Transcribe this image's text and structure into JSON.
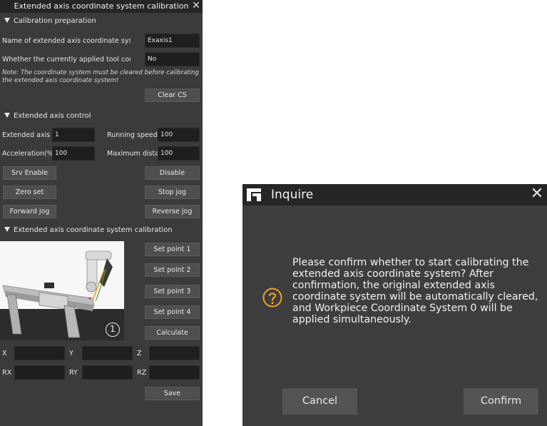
{
  "panel": {
    "title": "Extended axis coordinate system calibration",
    "section_prep": "Calibration preparation",
    "cs_name_label": "Name of extended axis coordinate system",
    "cs_name_value": "Exaxis1",
    "tool_label": "Whether the currently applied tool coordi",
    "tool_value": "No",
    "note": "Note: The coordinate system must be cleared before calibrating the extended axis coordinate system!",
    "clear_cs": "Clear CS",
    "section_control": "Extended axis control",
    "axis_num_label": "Extended axis nu",
    "axis_num_value": "1",
    "speed_label": "Running speed(%",
    "speed_value": "100",
    "accel_label": "Acceleration(%)",
    "accel_value": "100",
    "maxdist_label": "Maximum distan",
    "maxdist_value": "100",
    "srv_enable": "Srv Enable",
    "disable": "Disable",
    "zero_set": "Zero set",
    "stop_jog": "Stop jog",
    "forward_jog": "Forward jog",
    "reverse_jog": "Reverse jog",
    "section_calib": "Extended axis coordinate system calibration",
    "set_point_1": "Set point 1",
    "set_point_2": "Set point 2",
    "set_point_3": "Set point 3",
    "set_point_4": "Set point 4",
    "calculate": "Calculate",
    "illus_marker": "1",
    "x_label": "X",
    "y_label": "Y",
    "z_label": "Z",
    "rx_label": "RX",
    "ry_label": "RY",
    "rz_label": "RZ",
    "save": "Save"
  },
  "dialog": {
    "title": "Inquire",
    "message": "Please confirm whether to start calibrating the extended axis coordinate system? After confirmation, the original extended axis coordinate system will be automatically cleared, and Workpiece Coordinate System 0 will be applied simultaneously.",
    "cancel": "Cancel",
    "confirm": "Confirm"
  },
  "colors": {
    "panel_bg": "#3b3b3b",
    "titlebar_bg": "#262626",
    "input_bg": "#1f1f1f",
    "button_bg": "#4f4f4f",
    "dialog_bg": "#3e3e3e",
    "question_icon": "#f0a020"
  },
  "icons": [
    "close-icon",
    "triangle-down-icon",
    "app-logo-icon",
    "question-icon"
  ]
}
